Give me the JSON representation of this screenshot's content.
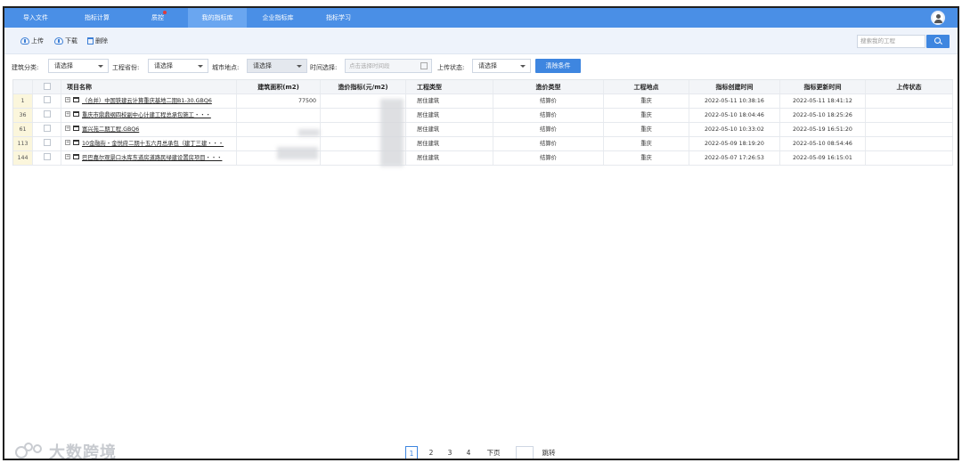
{
  "nav": {
    "tabs": [
      {
        "label": "导入文件",
        "active": false
      },
      {
        "label": "指标计算",
        "active": false
      },
      {
        "label": "质控",
        "active": false,
        "badge_dot": true
      },
      {
        "label": "我的指标库",
        "active": true
      },
      {
        "label": "企业指标库",
        "active": false
      },
      {
        "label": "指标学习",
        "active": false
      }
    ],
    "colors": {
      "bar": "#4a8fe6",
      "active_tab": "#6aa6f0",
      "dot": "#e03a3a"
    }
  },
  "toolbar": {
    "upload_label": "上传",
    "download_label": "下载",
    "delete_label": "删除",
    "search_placeholder": "搜索我的工程"
  },
  "filters": {
    "building_category": {
      "label": "建筑分类:",
      "value": "请选择"
    },
    "province": {
      "label": "工程省份:",
      "value": "请选择"
    },
    "city": {
      "label": "城市地点:",
      "value": "请选择"
    },
    "time": {
      "label": "时间选择:",
      "placeholder": "点击选择时间段"
    },
    "upload_status": {
      "label": "上传状态:",
      "value": "请选择"
    },
    "clear_label": "清除条件"
  },
  "table": {
    "columns": [
      "项目名称",
      "建筑面积(m2)",
      "造价指标(元/m2)",
      "工程类型",
      "造价类型",
      "工程地点",
      "指标创建时间",
      "指标更新时间",
      "上传状态"
    ],
    "rows": [
      {
        "index": "1",
        "name": "（合并）中国铁建云计算重庆基地二期B1-30.GBQ6",
        "area": "77500",
        "cost": "",
        "type": "居住建筑",
        "cost_type": "结算价",
        "location": "重庆",
        "created": "2022-05-11 10:38:16",
        "updated": "2022-05-11 18:41:12",
        "status": ""
      },
      {
        "index": "36",
        "name": "重庆市鼎鼎纲四校副中心计建工程总承包施工・・・",
        "area": "",
        "cost": "",
        "type": "居住建筑",
        "cost_type": "结算价",
        "location": "重庆",
        "created": "2022-05-10 18:04:46",
        "updated": "2022-05-10 18:25:26",
        "status": ""
      },
      {
        "index": "61",
        "name": "富兴苑二期工程.GBQ6",
        "area": "",
        "cost": "",
        "type": "居住建筑",
        "cost_type": "结算价",
        "location": "重庆",
        "created": "2022-05-10 10:33:02",
        "updated": "2022-05-19 16:51:20",
        "status": ""
      },
      {
        "index": "113",
        "name": "10金融街・金悦府二期十五六月总承包（建丁三建・・・",
        "area": "",
        "cost": "",
        "type": "居住建筑",
        "cost_type": "结算价",
        "location": "重庆",
        "created": "2022-05-09 18:19:20",
        "updated": "2022-05-10 08:54:46",
        "status": ""
      },
      {
        "index": "144",
        "name": "巴巴嘉尔观景口水库东道房道路民绿建设置房项目・・・",
        "area": "",
        "cost": "",
        "type": "居住建筑",
        "cost_type": "结算价",
        "location": "重庆",
        "created": "2022-05-07 17:26:53",
        "updated": "2022-05-09 16:15:01",
        "status": ""
      }
    ]
  },
  "pagination": {
    "pages": [
      "1",
      "2",
      "3",
      "4"
    ],
    "current": "1",
    "next_label": "下页",
    "jump_label": "跳转"
  },
  "watermark": {
    "text": "大数跨境"
  }
}
